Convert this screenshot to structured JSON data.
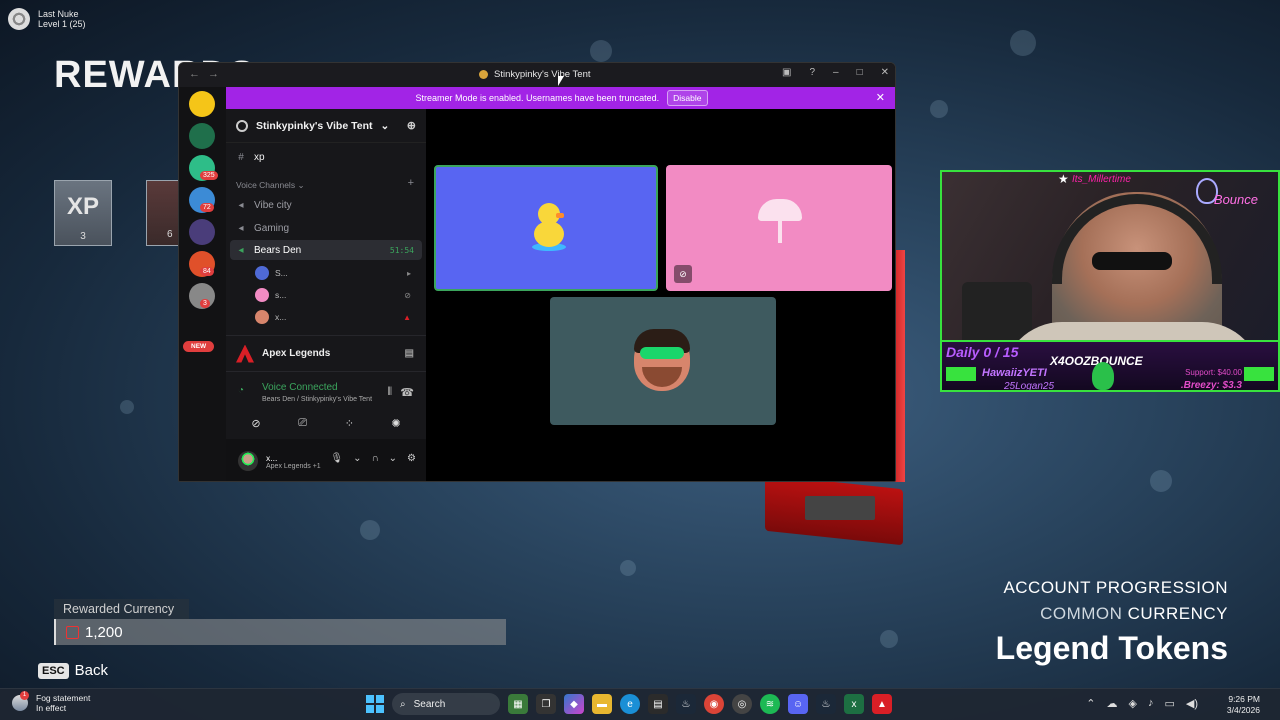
{
  "game": {
    "top_title": "Last Nuke",
    "top_subtitle": "Level 1  (25)",
    "rewards_title": "REWARDS",
    "xp_label": "XP",
    "xp_count": "3",
    "card2_count": "6",
    "rewarded_currency_label": "Rewarded Currency",
    "rewarded_currency_value": "1,200",
    "esc_key": "ESC",
    "back_label": "Back",
    "progression_line1": "ACCOUNT PROGRESSION",
    "progression_line2a": "COMMON",
    "progression_line2b": "CURRENCY",
    "progression_title": "Legend Tokens"
  },
  "webcam": {
    "top_name": "Its_Millertime",
    "daily": "Daily 0 / 15",
    "brand": "X4OOZBOUNCE",
    "name1": "HawaiizYETI",
    "name2": "25Logan25",
    "support": "Support: $40.00",
    "breezy": ".Breezy: $3.3",
    "neon": "Bounce"
  },
  "discord": {
    "window_title": "Stinkypinky's Vibe Tent",
    "banner_text": "Streamer Mode is enabled. Usernames have been truncated.",
    "banner_button": "Disable",
    "server_name": "Stinkypinky's Vibe Tent",
    "text_channel": "xp",
    "voice_category": "Voice Channels",
    "voice_channels": [
      "Vibe city",
      "Gaming"
    ],
    "active_channel": "Bears Den",
    "active_timer": "51:54",
    "voice_users": [
      "S...",
      "s...",
      "x..."
    ],
    "guild_badges": [
      "325",
      "72",
      "84",
      "3"
    ],
    "new_label": "NEW",
    "activity_name": "Apex Legends",
    "vc_status": "Voice Connected",
    "vc_sub": "Bears Den / Stinkypinky's Vibe Tent",
    "user_name": "x...",
    "user_status": "Apex Legends +1"
  },
  "taskbar": {
    "weather_title": "Fog statement",
    "weather_sub": "In effect",
    "weather_badge": "1",
    "search_placeholder": "Search",
    "time": "9:26 PM",
    "date": "3/4/2026"
  },
  "colors": {
    "discord_blurple": "#5865f2",
    "streamer_banner": "#a224e6",
    "voice_green": "#3ba55d",
    "apex_red": "#d91f26"
  }
}
